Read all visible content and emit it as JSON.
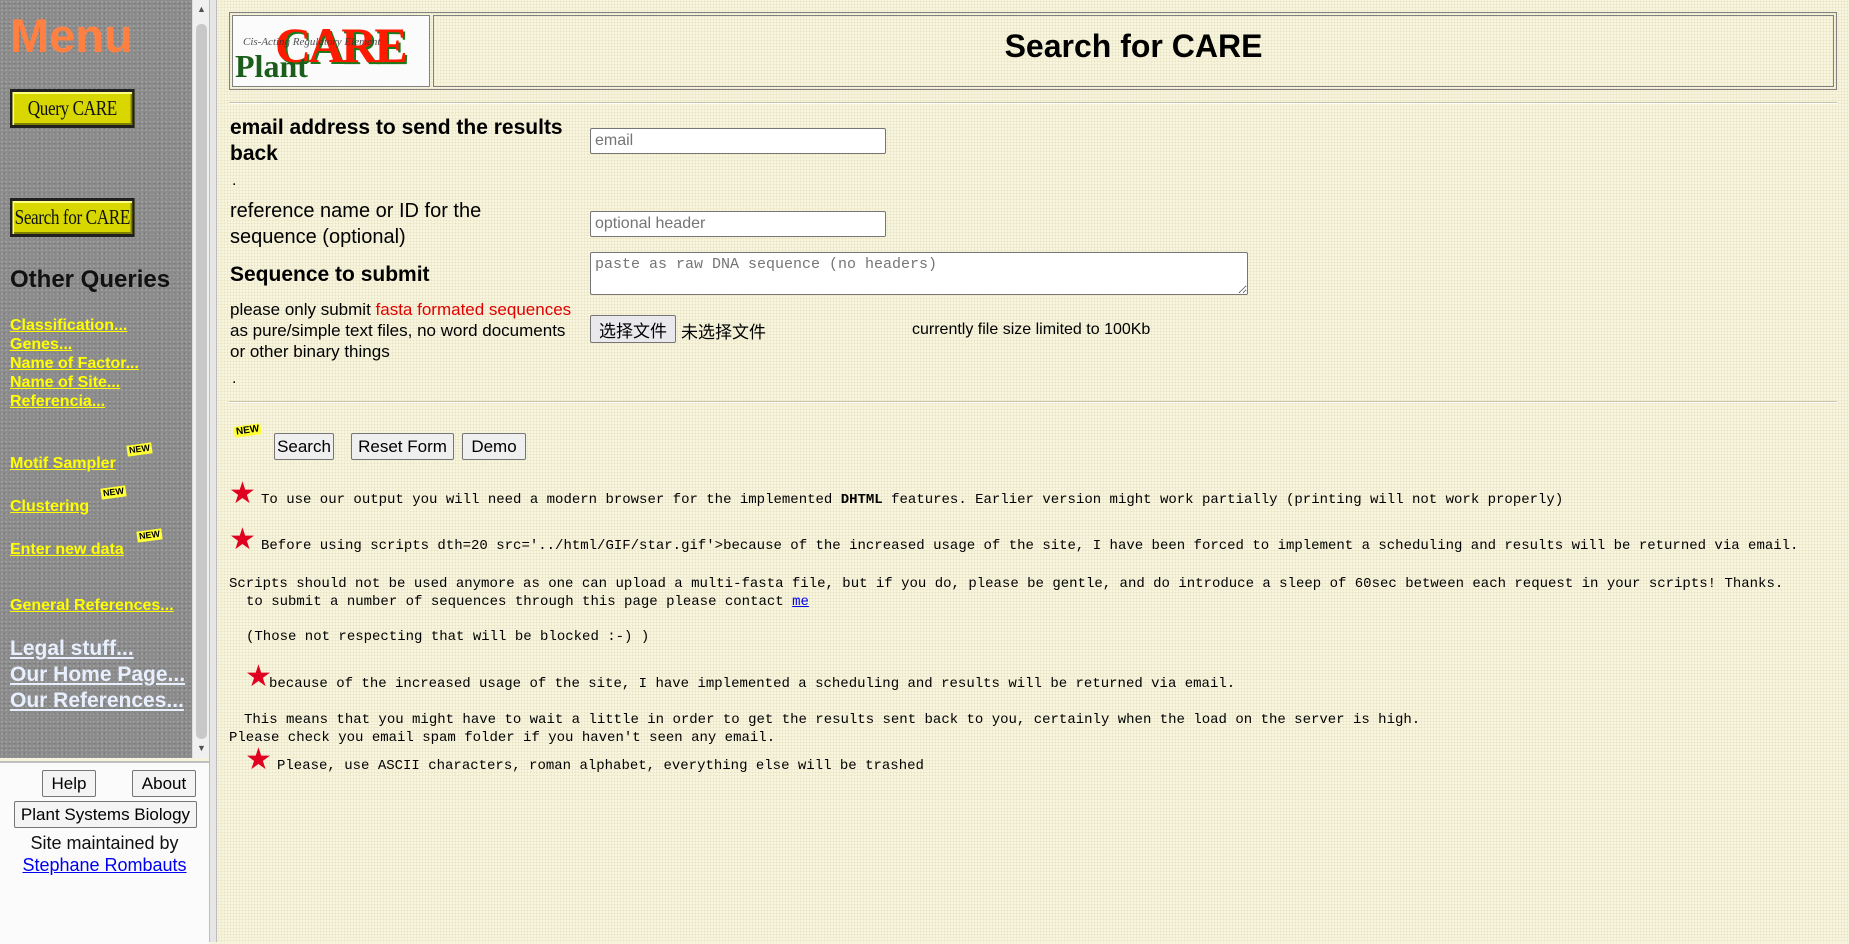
{
  "menu": {
    "title": "Menu",
    "query_care": "Query CARE",
    "search_care": "Search for CARE",
    "other_queries": "Other Queries",
    "links": [
      "Classification...",
      "Genes...",
      "Name of Factor...",
      "Name of Site...",
      "Referencia..."
    ],
    "motif_sampler": "Motif Sampler",
    "clustering": "Clustering",
    "enter_new_data": "Enter new data",
    "new_badge": "NEW",
    "general_references": "General References...",
    "legal": "Legal stuff...",
    "home": "Our Home Page...",
    "references": "Our References..."
  },
  "footer": {
    "help": "Help",
    "about": "About",
    "psb": "Plant Systems Biology",
    "maintained": "Site maintained by",
    "author": "Stephane Rombauts"
  },
  "header": {
    "logo_plant": "Plant",
    "logo_care": "CARE",
    "logo_sub": "Cis-Acting Regulatory Element",
    "title": "Search for CARE"
  },
  "form": {
    "email_label": "email address to send the results back",
    "email_placeholder": "email",
    "dot": ".",
    "ref_label": "reference name or ID for the sequence (optional)",
    "ref_placeholder": "optional header",
    "seq_label": "Sequence to submit",
    "seq_placeholder": "paste as raw DNA sequence (no headers)",
    "submit_note_1": "please only submit ",
    "submit_note_red": "fasta formated sequences",
    "submit_note_2": "as pure/simple text files, no word documents",
    "submit_note_3": "or other binary things",
    "file_button": "选择文件",
    "file_status": "未选择文件",
    "file_limit": "currently file size limited to 100Kb",
    "new_badge": "NEW",
    "search": "Search",
    "reset": "Reset Form",
    "demo": "Demo"
  },
  "notes": {
    "star": "★",
    "n1_pre": "To use our output you will need a modern browser for the implemented ",
    "n1_bold": "DHTML",
    "n1_post": " features. Earlier version might work partially (printing will not work properly)",
    "n2": "Before using scripts dth=20 src='../html/GIF/star.gif'>because of the increased usage of the site, I have been forced to implement a scheduling and results will be returned via email.",
    "n3": "Scripts should not be used anymore as one can upload a multi-fasta file, but if you do, please be gentle, and do introduce a sleep of 60sec between each request in your scripts! Thanks.",
    "n4_pre": "to submit a number of sequences through this page please contact ",
    "n4_link": "me",
    "n5": "(Those not respecting that will be blocked :-) )",
    "n6": "because of the increased usage of the site, I have implemented a scheduling and results will be returned via email.",
    "n7": "This means that you might have to wait a little in order to get the results sent back to you, certainly when the load on the server is high.",
    "n8": "Please check you email spam folder if you haven't seen any email.",
    "n9": "Please, use ASCII characters, roman alphabet, everything else will be trashed"
  }
}
